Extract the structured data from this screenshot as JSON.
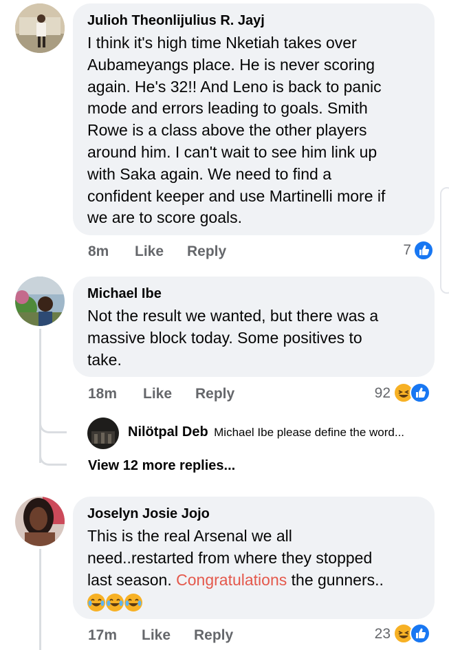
{
  "comments": [
    {
      "author": "Julioh Theonlijulius R. Jayj",
      "lines": [
        "I think it's high time Nketiah takes over",
        "Aubameyangs place. He is never scoring",
        "again. He's 32!! And Leno is back to panic",
        "mode and errors leading to goals. Smith",
        "Rowe is a class above the other players",
        "around him. I can't wait to see him link up",
        "with Saka again. We need to find a",
        "confident keeper and use Martinelli more if",
        "we are to score goals."
      ],
      "time": "8m",
      "like": "Like",
      "reply": "Reply",
      "reactions": "7"
    },
    {
      "author": "Michael Ibe",
      "lines": [
        "Not the result we wanted, but there was a",
        "massive block today. Some positives to",
        "take."
      ],
      "time": "18m",
      "like": "Like",
      "reply": "Reply",
      "reactions": "92",
      "reply_preview": {
        "author": "Nilötpal Deb",
        "text": "Michael Ibe please define the word..."
      },
      "view_more": "View 12 more replies..."
    },
    {
      "author": "Joselyn Josie Jojo",
      "line1": "This is the real Arsenal we all",
      "line2": "need..restarted from where they stopped",
      "line3_pre": "last season.",
      "line3_mention": "Congratulations",
      "line3_post": "the gunners..",
      "time": "17m",
      "like": "Like",
      "reply": "Reply",
      "reactions": "23"
    }
  ],
  "colors": {
    "bubble": "#f0f2f5",
    "like_blue": "#1877f2",
    "haha_yellow": "#f7b125",
    "mention": "#e4584b",
    "meta_gray": "#65676b"
  },
  "icons": [
    "like-reaction-icon",
    "haha-reaction-icon",
    "laughing-emoji-icon"
  ]
}
